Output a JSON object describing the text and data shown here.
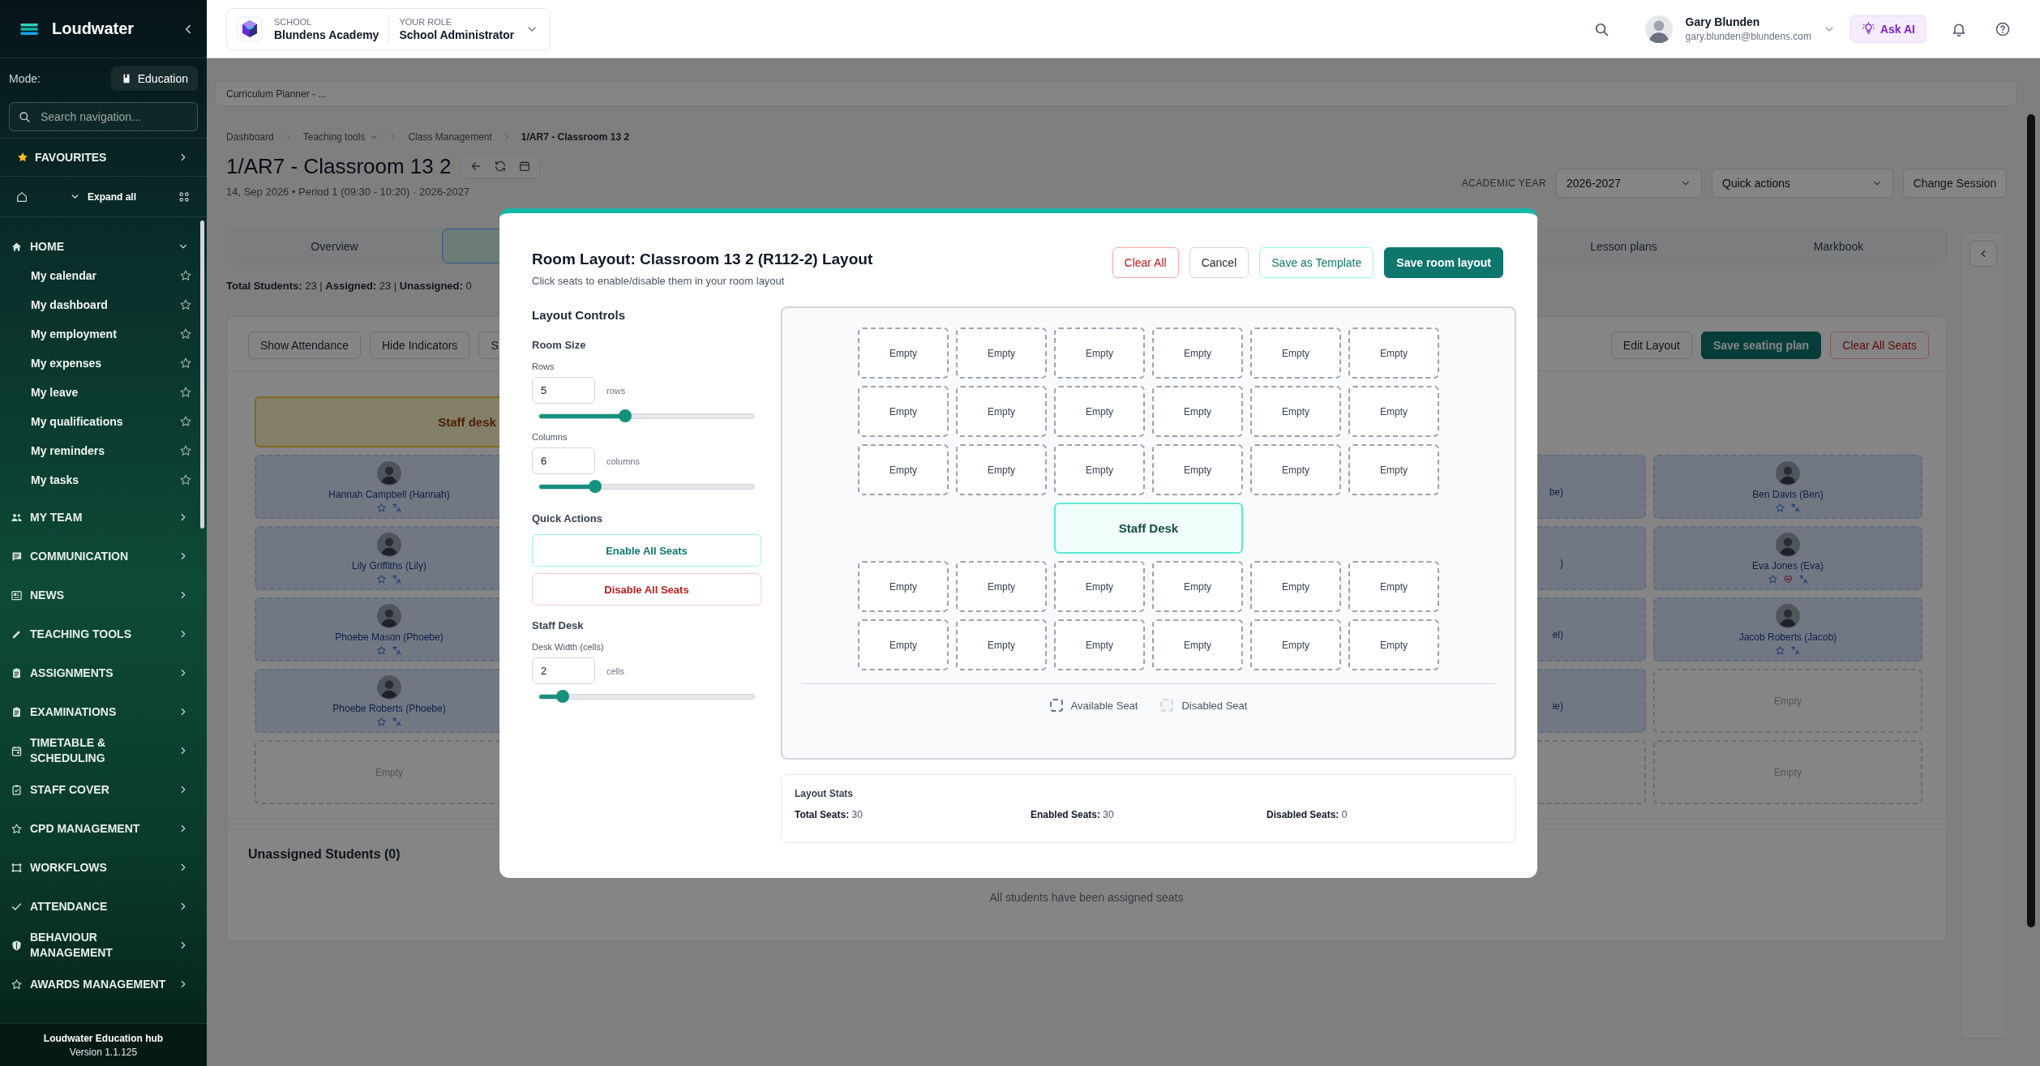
{
  "sidebar": {
    "app_name": "Loudwater",
    "mode_label": "Mode:",
    "mode": "Education",
    "search_placeholder": "Search navigation...",
    "favourites": "FAVOURITES",
    "expand_all": "Expand all",
    "sections": [
      {
        "label": "HOME",
        "expanded": true,
        "children": [
          {
            "label": "My calendar"
          },
          {
            "label": "My dashboard"
          },
          {
            "label": "My employment"
          },
          {
            "label": "My expenses"
          },
          {
            "label": "My leave"
          },
          {
            "label": "My qualifications"
          },
          {
            "label": "My reminders"
          },
          {
            "label": "My tasks"
          }
        ]
      },
      {
        "label": "MY TEAM",
        "expanded": false
      },
      {
        "label": "COMMUNICATION",
        "expanded": false
      },
      {
        "label": "NEWS",
        "expanded": false
      },
      {
        "label": "TEACHING TOOLS",
        "expanded": false
      },
      {
        "label": "ASSIGNMENTS",
        "expanded": false
      },
      {
        "label": "EXAMINATIONS",
        "expanded": false
      },
      {
        "label": "TIMETABLE & SCHEDULING",
        "expanded": false
      },
      {
        "label": "STAFF COVER",
        "expanded": false
      },
      {
        "label": "CPD MANAGEMENT",
        "expanded": false
      },
      {
        "label": "WORKFLOWS",
        "expanded": false
      },
      {
        "label": "ATTENDANCE",
        "expanded": false
      },
      {
        "label": "BEHAVIOUR MANAGEMENT",
        "expanded": false
      },
      {
        "label": "AWARDS MANAGEMENT",
        "expanded": false
      }
    ],
    "footer_title": "Loudwater Education hub",
    "footer_version": "Version 1.1.125"
  },
  "topbar": {
    "school_label": "SCHOOL",
    "school": "Blundens Academy",
    "role_label": "YOUR ROLE",
    "role": "School Administrator",
    "user_name": "Gary Blunden",
    "user_email": "gary.blunden@blundens.com",
    "ask_ai": "Ask AI"
  },
  "page": {
    "info_bar": "Curriculum Planner - ...",
    "breadcrumb": [
      {
        "label": "Dashboard",
        "kind": "link"
      },
      {
        "label": "Teaching tools",
        "kind": "dropdown"
      },
      {
        "label": "Class Management",
        "kind": "link"
      },
      {
        "label": "1/AR7 - Classroom 13 2",
        "kind": "current"
      }
    ],
    "title": "1/AR7 - Classroom 13 2",
    "subtitle": "14, Sep 2026 • Period 1 (09:30 - 10:20) · 2026-2027",
    "academic_year_label": "ACADEMIC YEAR",
    "academic_year": "2026-2027",
    "quick_actions": "Quick actions",
    "change_session": "Change Session",
    "tabs": [
      {
        "label": "Overview",
        "selected": false
      },
      {
        "selected": true
      },
      {
        "label": "Lesson plans",
        "selected": false
      },
      {
        "label": "Markbook",
        "selected": false
      }
    ],
    "totals": "**Total Students:** 23 | **Assigned:** 23 | **Unassigned:** 0",
    "toolbar_left": [
      "Show Attendance",
      "Hide Indicators",
      "S"
    ],
    "toolbar_right": [
      {
        "label": "Edit Layout",
        "kind": "outline"
      },
      {
        "label": "Save seating plan",
        "kind": "primary"
      },
      {
        "label": "Clear All Seats",
        "kind": "danger"
      }
    ],
    "staff_desk": "Staff desk",
    "seat_columns": [
      {
        "kind": "full",
        "seats": [
          {
            "kind": "student",
            "name": "Hannah Campbell (Hannah)",
            "medical": false
          },
          {
            "kind": "student",
            "name": "Lily Griffiths (Lily)",
            "medical": false
          },
          {
            "kind": "student",
            "name": "Phoebe Mason (Phoebe)",
            "medical": false
          },
          {
            "kind": "student",
            "name": "Phoebe Roberts (Phoebe)",
            "medical": false
          },
          {
            "kind": "empty",
            "label": "Empty"
          }
        ]
      },
      {
        "kind": "cut",
        "seats": [
          {
            "kind": "student",
            "name": "be)"
          },
          {
            "kind": "student",
            "name": ")"
          },
          {
            "kind": "student",
            "name": "el)"
          },
          {
            "kind": "student",
            "name": "ie)"
          },
          {
            "kind": "empty"
          }
        ]
      },
      {
        "kind": "full",
        "seats": [
          {
            "kind": "student",
            "name": "Ben Davis (Ben)",
            "medical": false
          },
          {
            "kind": "student",
            "name": "Eva Jones (Eva)",
            "medical": true
          },
          {
            "kind": "student",
            "name": "Jacob Roberts (Jacob)",
            "medical": false
          },
          {
            "kind": "empty",
            "label": "Empty"
          },
          {
            "kind": "empty",
            "label": "Empty"
          }
        ]
      }
    ],
    "unassigned_title": "Unassigned Students (0)",
    "unassigned_note": "All students have been assigned seats"
  },
  "modal": {
    "title": "Room Layout: Classroom 13 2 (R112-2) Layout",
    "subtitle": "Click seats to enable/disable them in your room layout",
    "buttons": [
      {
        "label": "Clear All",
        "kind": "danger"
      },
      {
        "label": "Cancel",
        "kind": "outline"
      },
      {
        "label": "Save as Template",
        "kind": "teal_outline"
      },
      {
        "label": "Save room layout",
        "kind": "primary"
      }
    ],
    "controls_title": "Layout Controls",
    "room_size_title": "Room Size",
    "fields": [
      {
        "label": "Rows",
        "value": "5",
        "unit": "rows",
        "level": 0.4
      },
      {
        "label": "Columns",
        "value": "6",
        "unit": "columns",
        "level": 0.26
      }
    ],
    "quick_actions_title": "Quick Actions",
    "quick_actions": [
      {
        "label": "Enable All Seats",
        "kind": "enable"
      },
      {
        "label": "Disable All Seats",
        "kind": "disable"
      }
    ],
    "staff_desk_title": "Staff Desk",
    "desk_field": {
      "label": "Desk Width (cells)",
      "value": "2",
      "unit": "cells",
      "level": 0.11
    },
    "grid": [
      {
        "kind": "seats",
        "seats": [
          {
            "label": "Empty",
            "enabled": true
          },
          {
            "label": "Empty",
            "enabled": true
          },
          {
            "label": "Empty",
            "enabled": true
          },
          {
            "label": "Empty",
            "enabled": true
          },
          {
            "label": "Empty",
            "enabled": true
          },
          {
            "label": "Empty",
            "enabled": true
          }
        ]
      },
      {
        "kind": "seats",
        "seats": [
          {
            "label": "Empty",
            "enabled": true
          },
          {
            "label": "Empty",
            "enabled": true
          },
          {
            "label": "Empty",
            "enabled": true
          },
          {
            "label": "Empty",
            "enabled": true
          },
          {
            "label": "Empty",
            "enabled": true
          },
          {
            "label": "Empty",
            "enabled": true
          }
        ]
      },
      {
        "kind": "seats",
        "seats": [
          {
            "label": "Empty",
            "enabled": true
          },
          {
            "label": "Empty",
            "enabled": true
          },
          {
            "label": "Empty",
            "enabled": true
          },
          {
            "label": "Empty",
            "enabled": true
          },
          {
            "label": "Empty",
            "enabled": true
          },
          {
            "label": "Empty",
            "enabled": true
          }
        ]
      },
      {
        "kind": "staff_desk",
        "label": "Staff Desk"
      },
      {
        "kind": "seats",
        "seats": [
          {
            "label": "Empty",
            "enabled": true
          },
          {
            "label": "Empty",
            "enabled": true
          },
          {
            "label": "Empty",
            "enabled": true
          },
          {
            "label": "Empty",
            "enabled": true
          },
          {
            "label": "Empty",
            "enabled": true
          },
          {
            "label": "Empty",
            "enabled": true
          }
        ]
      },
      {
        "kind": "seats",
        "seats": [
          {
            "label": "Empty",
            "enabled": true
          },
          {
            "label": "Empty",
            "enabled": true
          },
          {
            "label": "Empty",
            "enabled": true
          },
          {
            "label": "Empty",
            "enabled": true
          },
          {
            "label": "Empty",
            "enabled": true
          },
          {
            "label": "Empty",
            "enabled": true
          }
        ]
      }
    ],
    "legend": [
      {
        "kind": "available",
        "label": "Available Seat"
      },
      {
        "kind": "disabled",
        "label": "Disabled Seat"
      }
    ],
    "stats_title": "Layout Stats",
    "stats": [
      "**Total Seats:** 30",
      "**Enabled Seats:** 30",
      "**Disabled Seats:** 0"
    ]
  }
}
